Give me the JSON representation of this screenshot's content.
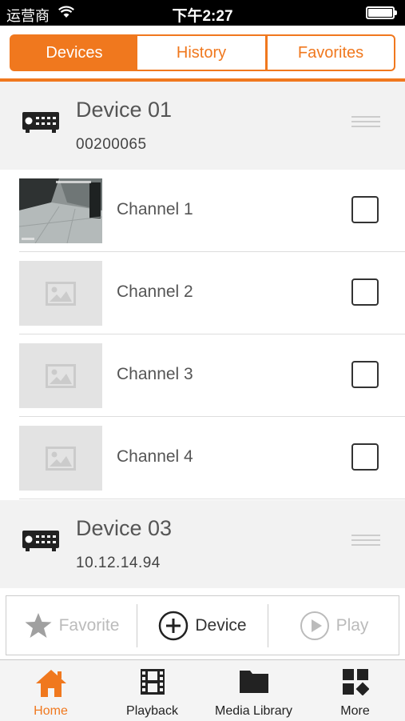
{
  "status_bar": {
    "carrier": "运营商",
    "time": "下午2:27"
  },
  "tabs_top": [
    "Devices",
    "History",
    "Favorites"
  ],
  "devices": [
    {
      "name": "Device 01",
      "id": "00200065"
    },
    {
      "name": "Device 03",
      "id": "10.12.14.94"
    }
  ],
  "channels": [
    "Channel 1",
    "Channel 2",
    "Channel 3",
    "Channel 4"
  ],
  "actions": {
    "favorite": "Favorite",
    "device": "Device",
    "play": "Play"
  },
  "tab_bar": [
    "Home",
    "Playback",
    "Media Library",
    "More"
  ],
  "colors": {
    "accent": "#f0781e"
  }
}
